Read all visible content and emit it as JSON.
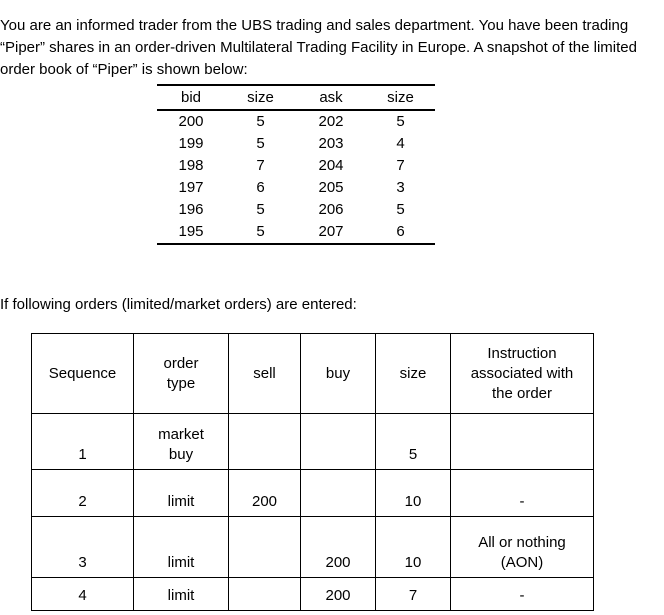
{
  "intro": {
    "paragraph": "You are an informed trader from the UBS trading and sales department. You have been trading “Piper” shares in an order-driven Multilateral Trading Facility in Europe. A snapshot of the limited order book of “Piper” is shown below:"
  },
  "order_book": {
    "headers": [
      "bid",
      "size",
      "ask",
      "size"
    ],
    "rows": [
      [
        "200",
        "5",
        "202",
        "5"
      ],
      [
        "199",
        "5",
        "203",
        "4"
      ],
      [
        "198",
        "7",
        "204",
        "7"
      ],
      [
        "197",
        "6",
        "205",
        "3"
      ],
      [
        "196",
        "5",
        "206",
        "5"
      ],
      [
        "195",
        "5",
        "207",
        "6"
      ]
    ]
  },
  "mid_text": {
    "sentence": "If following orders (limited/market orders) are entered:"
  },
  "orders_table": {
    "headers": [
      "Sequence",
      "order\ntype",
      "sell",
      "buy",
      "size",
      "Instruction\nassociated with\nthe order"
    ],
    "rows": [
      {
        "sequence": "1",
        "order_type": "market\nbuy",
        "sell": "",
        "buy": "",
        "size": "5",
        "instruction": ""
      },
      {
        "sequence": "2",
        "order_type": "limit",
        "sell": "200",
        "buy": "",
        "size": "10",
        "instruction": "-"
      },
      {
        "sequence": "3",
        "order_type": "limit",
        "sell": "",
        "buy": "200",
        "size": "10",
        "instruction": "All or nothing\n(AON)"
      },
      {
        "sequence": "4",
        "order_type": "limit",
        "sell": "",
        "buy": "200",
        "size": "7",
        "instruction": "-"
      }
    ]
  }
}
